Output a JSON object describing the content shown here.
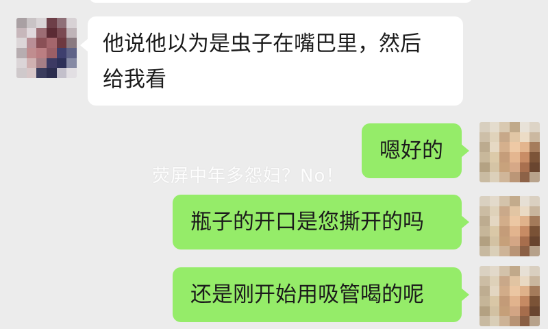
{
  "messages": [
    {
      "side": "left",
      "text_line1": "他说他以为是虫子在嘴巴里，然后",
      "text_line2": "给我看"
    },
    {
      "side": "right",
      "text": "嗯好的"
    },
    {
      "side": "right",
      "text": "瓶子的开口是您撕开的吗"
    },
    {
      "side": "right",
      "text": "还是刚开始用吸管喝的呢"
    }
  ],
  "watermark": "荧屏中年多怨妇？No！",
  "colors": {
    "background": "#ececec",
    "incoming_bubble": "#ffffff",
    "outgoing_bubble": "#95ec69"
  },
  "avatars": {
    "contact": "pixelated-avatar",
    "self": "pixelated-avatar"
  }
}
